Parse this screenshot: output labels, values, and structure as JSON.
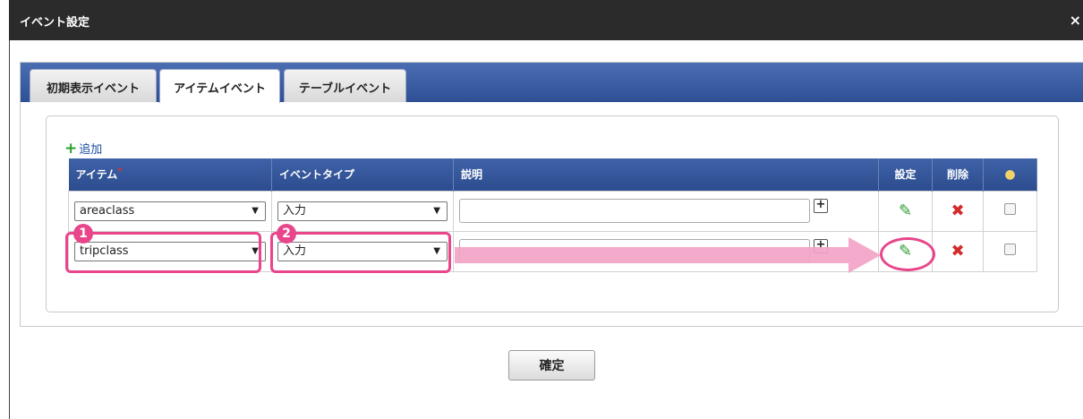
{
  "dialog": {
    "title": "イベント設定",
    "close_label": "×"
  },
  "tabs": [
    {
      "label": "初期表示イベント"
    },
    {
      "label": "アイテムイベント"
    },
    {
      "label": "テーブルイベント"
    }
  ],
  "add_label": "追加",
  "table": {
    "headers": {
      "item": "アイテム",
      "required_mark": "*",
      "event_type": "イベントタイプ",
      "description": "説明",
      "settings": "設定",
      "delete": "削除"
    },
    "rows": [
      {
        "item": "areaclass",
        "event_type": "入力",
        "description": ""
      },
      {
        "item": "tripclass",
        "event_type": "入力",
        "description": ""
      }
    ]
  },
  "annotations": {
    "badge_1": "1",
    "badge_2": "2"
  },
  "confirm_label": "確定",
  "icons": {
    "pencil": "pencil-icon",
    "delete": "delete-x-icon",
    "hint": "lightbulb-icon",
    "add": "plus-icon"
  },
  "colors": {
    "header_blue": "#2e4f93",
    "annotation_pink": "#e8458b",
    "pencil_green": "#2f9a2f",
    "delete_red": "#d42a2a"
  }
}
